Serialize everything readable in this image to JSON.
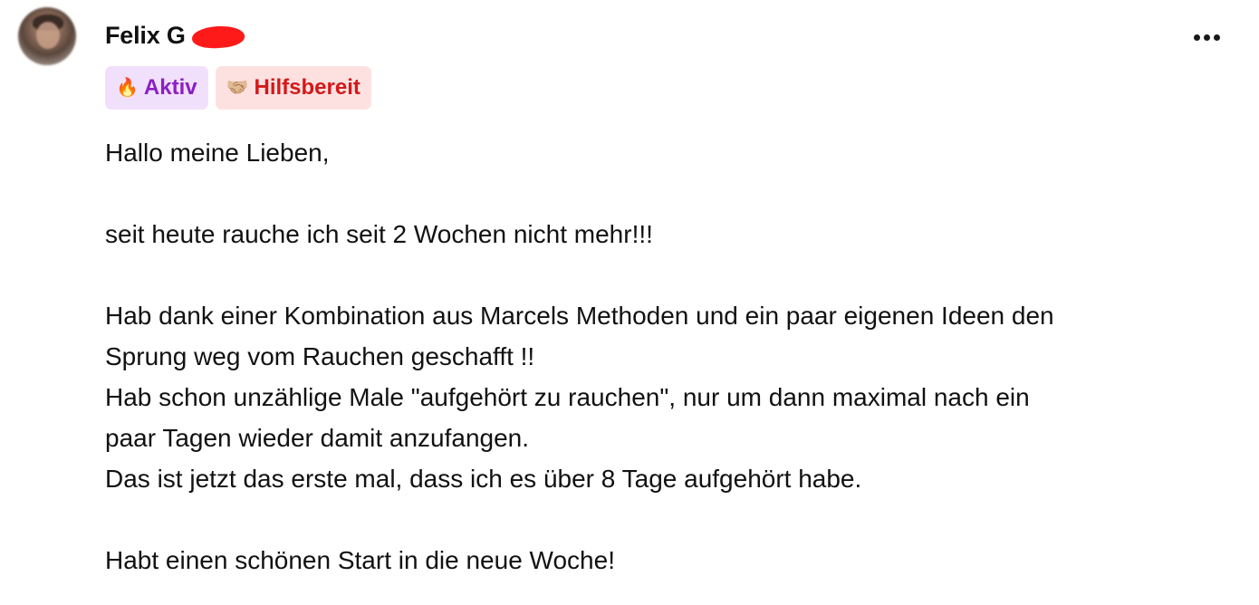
{
  "author": {
    "name": "Felix G",
    "avatar_alt": "avatar"
  },
  "menu": {
    "more_icon": "more-horizontal-icon"
  },
  "badges": [
    {
      "icon": "🔥",
      "label": "Aktiv",
      "color": "#8b1fc4",
      "background": "#f1e0fb"
    },
    {
      "icon": "🤝🏼",
      "label": "Hilfsbereit",
      "color": "#d31919",
      "background": "#fde1e1"
    }
  ],
  "post": {
    "paragraphs": [
      "Hallo meine Lieben,",
      "seit heute rauche ich seit 2 Wochen nicht mehr!!!",
      "Hab dank einer Kombination aus Marcels Methoden und ein paar eigenen Ideen den\nSprung weg vom Rauchen geschafft !!\nHab schon unzählige Male \"aufgehört zu rauchen\", nur um dann maximal nach ein\npaar Tagen wieder damit anzufangen.\nDas ist jetzt das erste mal, dass ich es über 8 Tage aufgehört habe.",
      "Habt einen schönen Start in die neue Woche!"
    ]
  }
}
